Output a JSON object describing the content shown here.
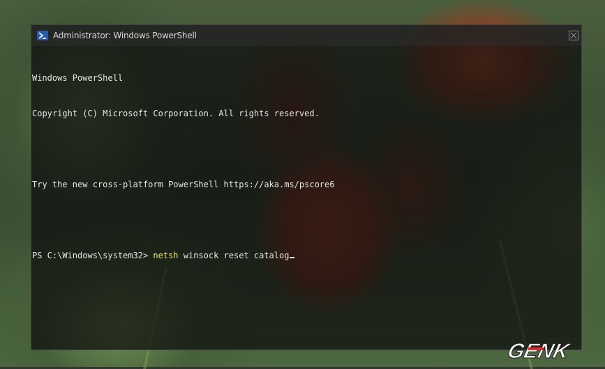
{
  "window": {
    "title": "Administrator: Windows PowerShell",
    "icon": "powershell-icon",
    "close_icon": "close-icon"
  },
  "console": {
    "lines": [
      "Windows PowerShell",
      "Copyright (C) Microsoft Corporation. All rights reserved.",
      "",
      "Try the new cross-platform PowerShell https://aka.ms/pscore6",
      ""
    ],
    "prompt": "PS C:\\Windows\\system32> ",
    "command": "netsh",
    "arguments": " winsock reset catalog"
  },
  "watermark": {
    "text": "GENK"
  },
  "colors": {
    "command": "#f3e96a",
    "text": "#e6e6e6",
    "brand_red": "#e32a2a"
  }
}
